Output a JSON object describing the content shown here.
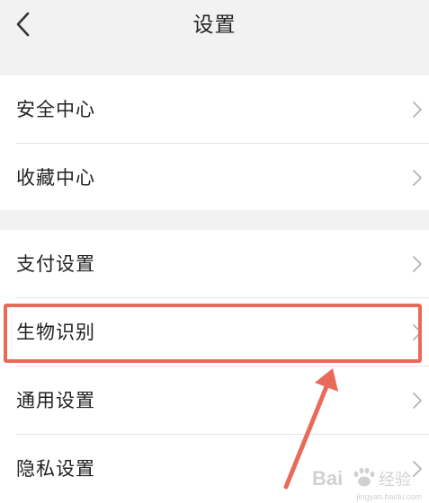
{
  "header": {
    "title": "设置",
    "back_icon": "chevron-left-icon"
  },
  "groups": [
    {
      "items": [
        {
          "label": "安全中心",
          "icon": "chevron-right-icon"
        },
        {
          "label": "收藏中心",
          "icon": "chevron-right-icon"
        }
      ]
    },
    {
      "items": [
        {
          "label": "支付设置",
          "icon": "chevron-right-icon"
        },
        {
          "label": "生物识别",
          "icon": "chevron-right-icon",
          "highlighted": true
        },
        {
          "label": "通用设置",
          "icon": "chevron-right-icon"
        },
        {
          "label": "隐私设置",
          "icon": "chevron-right-icon"
        }
      ]
    }
  ],
  "annotation": {
    "color": "#ea6a5a",
    "highlight_target": "生物识别"
  },
  "watermark": {
    "brand": "Baidu 经验",
    "url": "jingyan.baidu.com"
  },
  "colors": {
    "background": "#f2f2f2",
    "card": "#ffffff",
    "text": "#222222",
    "chevron": "#b4b4b4",
    "divider": "#e4e4e4"
  }
}
